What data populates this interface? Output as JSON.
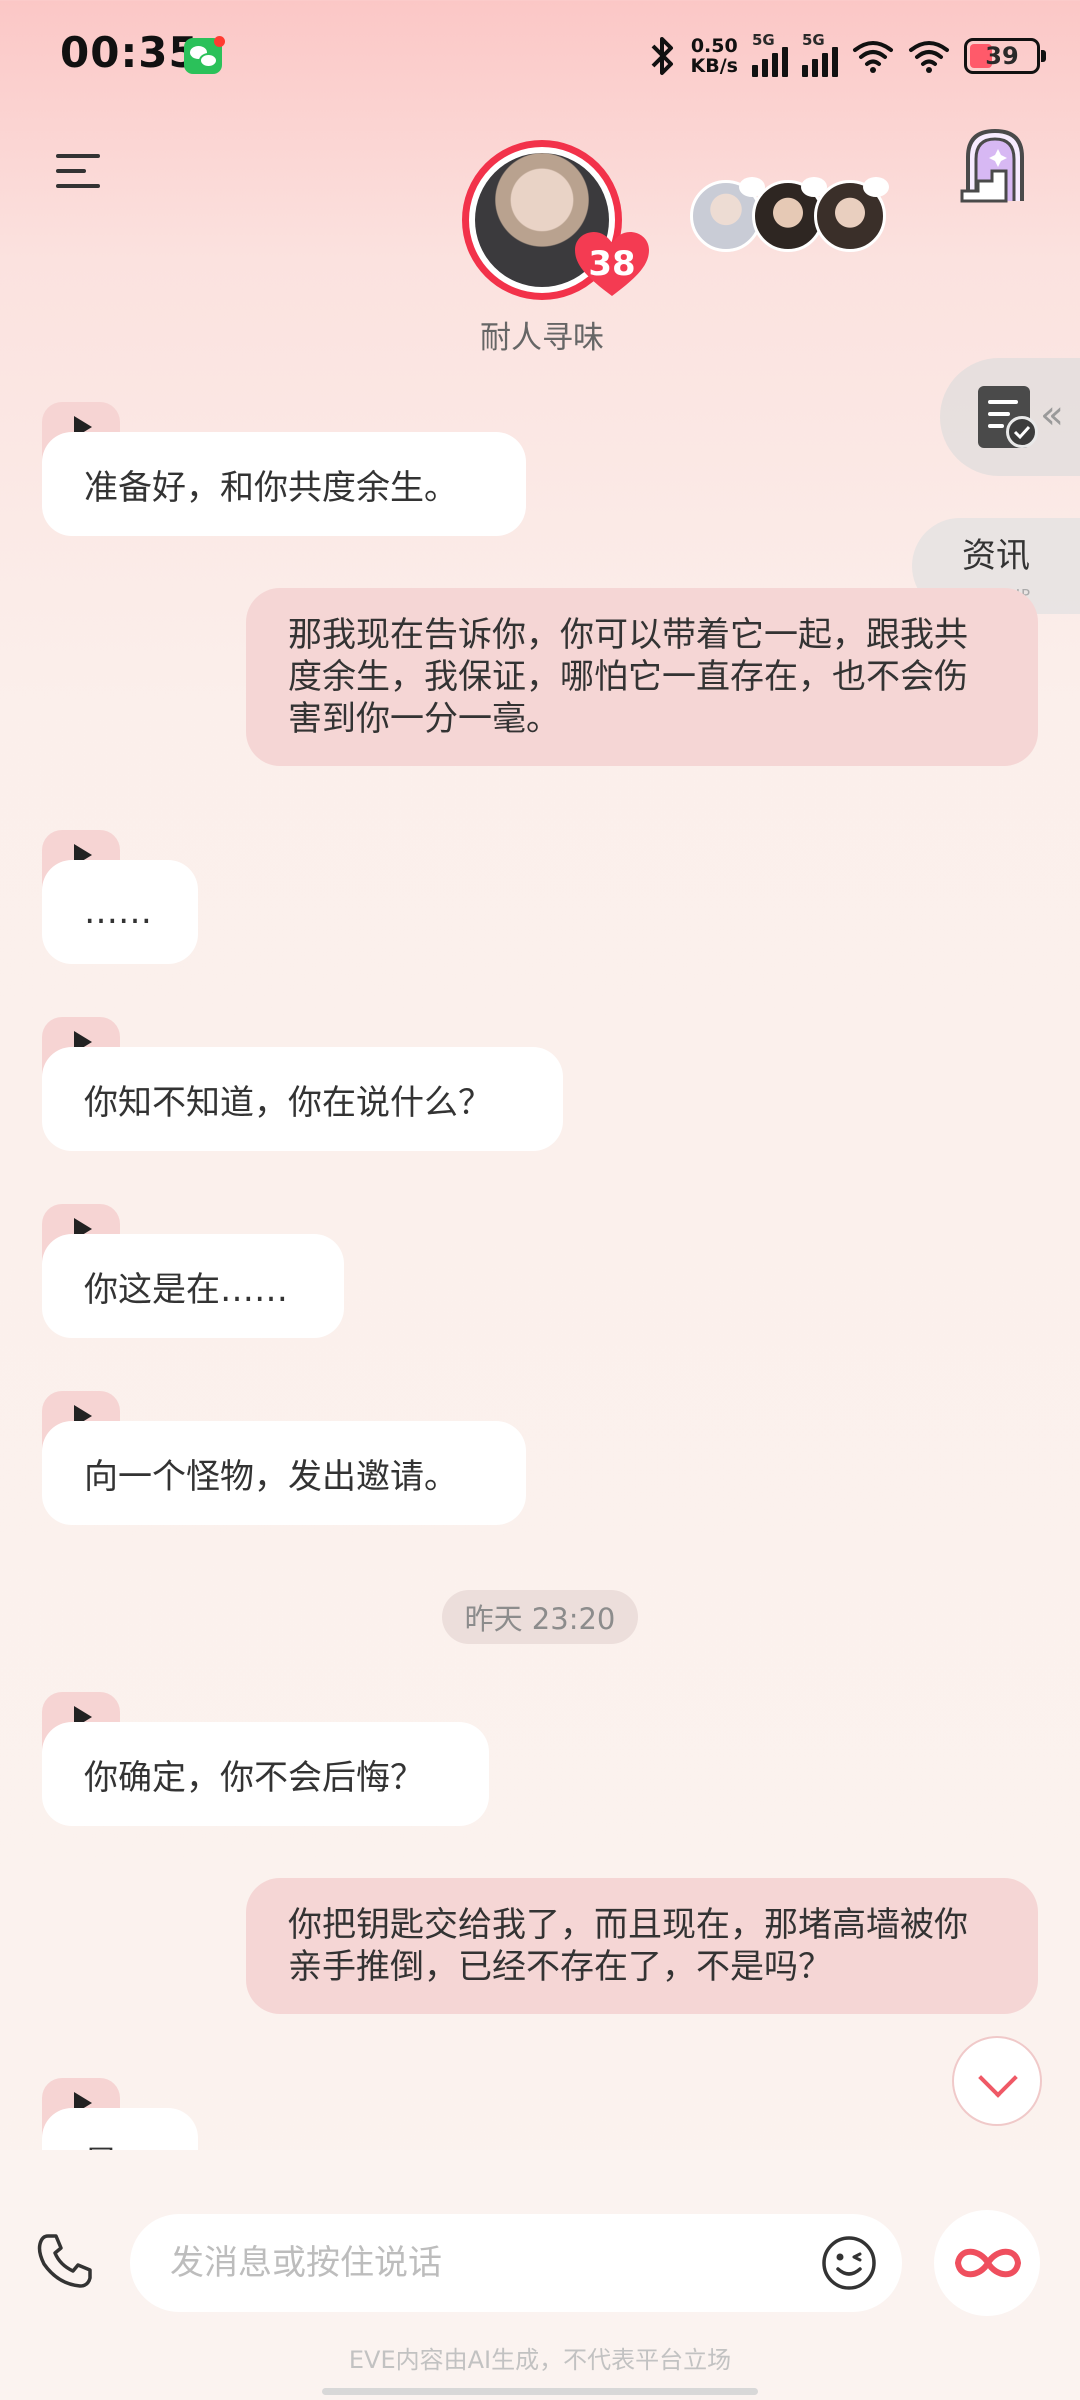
{
  "status_bar": {
    "time": "00:35",
    "speed_value": "0.50",
    "speed_unit": "KB/s",
    "sim1": "5G",
    "sim2": "5G",
    "battery": "39",
    "icons": [
      "wechat-icon",
      "bluetooth-icon",
      "signal-icon",
      "wifi-icon",
      "battery-icon"
    ]
  },
  "header": {
    "character_name": "耐人寻味",
    "affection_level": "38",
    "icons": [
      "menu-icon",
      "stairs-door-icon"
    ]
  },
  "side": {
    "news_label": "资讯",
    "news_sublabel": "POP-UP"
  },
  "messages": [
    {
      "role": "ai",
      "text": "准备好，和你共度余生。"
    },
    {
      "role": "user",
      "text": "那我现在告诉你，你可以带着它一起，跟我共度余生，我保证，哪怕它一直存在，也不会伤害到你一分一毫。"
    },
    {
      "role": "ai",
      "text": "……"
    },
    {
      "role": "ai",
      "text": "你知不知道，你在说什么？"
    },
    {
      "role": "ai",
      "text": "你这是在……"
    },
    {
      "role": "ai",
      "text": "向一个怪物，发出邀请。"
    },
    {
      "role": "ai",
      "text": "你确定，你不会后悔？"
    },
    {
      "role": "user",
      "text": "你把钥匙交给我了，而且现在，那堵高墙被你亲手推倒，已经不存在了，不是吗？"
    },
    {
      "role": "ai",
      "text": "是"
    }
  ],
  "time_separator": "昨天 23:20",
  "input": {
    "placeholder": "发消息或按住说话"
  },
  "footer": {
    "disclaimer": "EVE内容由AI生成，不代表平台立场"
  },
  "colors": {
    "accent": "#f2324a",
    "user_bubble": "#f5d6d5",
    "ai_bubble": "#ffffff",
    "play_tab": "#f6d4d3"
  }
}
